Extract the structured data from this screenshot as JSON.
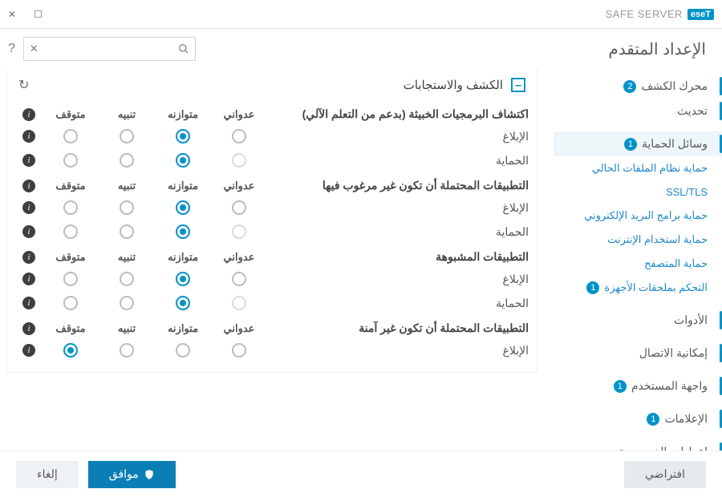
{
  "brand": {
    "badge": "eseT",
    "product": "SAFE SERVER"
  },
  "page_title": "الإعداد المتقدم",
  "search": {
    "placeholder": ""
  },
  "sidebar": [
    {
      "label": "محرك الكشف",
      "badge": "2",
      "top": true,
      "accent": true
    },
    {
      "label": "تحديث",
      "top": true,
      "accent": true
    },
    {
      "spacer": true
    },
    {
      "label": "وسائل الحماية",
      "badge": "1",
      "top": true,
      "accent": true,
      "selected": true
    },
    {
      "label": "حماية نظام الملفات الحالي",
      "sub": true
    },
    {
      "label": "SSL/TLS",
      "sub": true
    },
    {
      "label": "حماية برامج البريد الإلكتروني",
      "sub": true
    },
    {
      "label": "حماية استخدام الإنترنت",
      "sub": true
    },
    {
      "label": "حماية المتصفح",
      "sub": true
    },
    {
      "label": "التحكم بملحقات الأجهزة",
      "badge": "1",
      "sub": true
    },
    {
      "spacer": true
    },
    {
      "label": "الأدوات",
      "top": true,
      "accent": true
    },
    {
      "spacer": true
    },
    {
      "label": "إمكانية الاتصال",
      "top": true,
      "accent": true
    },
    {
      "spacer": true
    },
    {
      "label": "واجهة المستخدم",
      "badge": "1",
      "top": true,
      "accent": true
    },
    {
      "spacer": true
    },
    {
      "label": "الإعلامات",
      "badge": "1",
      "top": true,
      "accent": true
    },
    {
      "spacer": true
    },
    {
      "label": "إعدادات الخصوصية",
      "top": true,
      "accent": true
    }
  ],
  "section_title": "الكشف والاستجابات",
  "columns": {
    "c1": "عدواني",
    "c2": "متوازنه",
    "c3": "تنبيه",
    "c4": "متوقف"
  },
  "groups": [
    {
      "title": "اكتشاف البرمجيات الخبيثة (بدعم من التعلم الآلي)",
      "rows": [
        {
          "label": "الإبلاغ",
          "selected": 2
        },
        {
          "label": "الحماية",
          "selected": 2,
          "dim_first": true
        }
      ]
    },
    {
      "title": "التطبيقات المحتملة أن تكون غير مرغوب فيها",
      "rows": [
        {
          "label": "الإبلاغ",
          "selected": 2
        },
        {
          "label": "الحماية",
          "selected": 2,
          "dim_first": true
        }
      ]
    },
    {
      "title": "التطبيقات المشبوهة",
      "rows": [
        {
          "label": "الإبلاغ",
          "selected": 2
        },
        {
          "label": "الحماية",
          "selected": 2,
          "dim_first": true
        }
      ]
    },
    {
      "title": "التطبيقات المحتملة أن تكون غير آمنة",
      "rows": [
        {
          "label": "الإبلاغ",
          "selected": 4
        }
      ]
    }
  ],
  "buttons": {
    "defaults": "افتراضي",
    "ok": "موافق",
    "cancel": "إلغاء"
  }
}
